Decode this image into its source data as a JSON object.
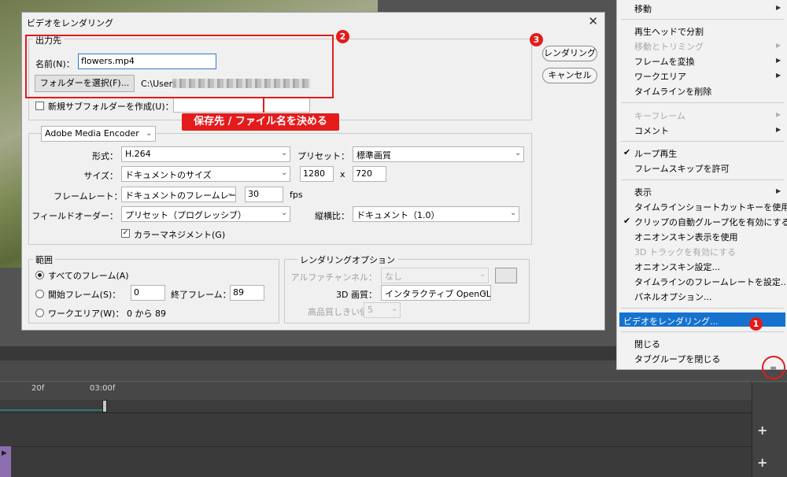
{
  "dialog": {
    "title": "ビデオをレンダリング",
    "close": "✕",
    "output_group": "出力先",
    "name_label": "名前(N)：",
    "name_value": "flowers.mp4",
    "folder_button": "フォルダーを選択(F)...",
    "path_prefix": "C:\\Users",
    "subfolder_label": "新規サブフォルダーを作成(U)：",
    "render_button": "レンダリング",
    "cancel_button": "キャンセル",
    "encoder": "Adobe Media Encoder",
    "format_label": "形式：",
    "format_value": "H.264",
    "preset_label": "プリセット：",
    "preset_value": "標準画質",
    "size_label": "サイズ：",
    "size_value": "ドキュメントのサイズ",
    "width": "1280",
    "x_sep": "x",
    "height": "720",
    "framerate_label": "フレームレート：",
    "framerate_value": "ドキュメントのフレームレート",
    "fps_value": "30",
    "fps_unit": "fps",
    "field_order_label": "フィールドオーダー：",
    "field_order_value": "プリセット（プログレッシブ）",
    "aspect_label": "縦横比：",
    "aspect_value": "ドキュメント（1.0）",
    "color_mgmt_label": "カラーマネジメント(G)",
    "range_group": "範囲",
    "all_frames": "すべてのフレーム(A)",
    "start_frame_label": "開始フレーム(S)：",
    "start_frame_value": "0",
    "end_frame_label": "終了フレーム：",
    "end_frame_value": "89",
    "work_area_label": "ワークエリア(W)：",
    "work_area_value": "0 から 89",
    "render_options_group": "レンダリングオプション",
    "alpha_label": "アルファチャンネル：",
    "alpha_value": "なし",
    "quality3d_label": "3D 画質：",
    "quality3d_value": "インタラクティブ OpenGL",
    "hq_threshold_label": "高品質しきい値：",
    "hq_threshold_value": "5"
  },
  "annotation": {
    "callout": "保存先 / ファイル名を決める",
    "badge1": "1",
    "badge2": "2",
    "badge3": "3"
  },
  "menu": {
    "items": [
      "移動",
      "再生ヘッドで分割",
      "移動とトリミング",
      "フレームを変換",
      "ワークエリア",
      "タイムラインを削除",
      "キーフレーム",
      "コメント",
      "ループ再生",
      "フレームスキップを許可",
      "表示",
      "タイムラインショートカットキーを使用",
      "クリップの自動グループ化を有効にする",
      "オニオンスキン表示を使用",
      "3D トラックを有効にする",
      "オニオンスキン設定...",
      "タイムラインのフレームレートを設定...",
      "パネルオプション...",
      "ビデオをレンダリング...",
      "閉じる",
      "タブグループを閉じる"
    ]
  },
  "timeline": {
    "tick_20f": "20f",
    "tick_3s": "03:00f",
    "add_track": "+"
  },
  "colors": {
    "accent_red": "#e31b1b",
    "menu_highlight": "#1672cf"
  }
}
